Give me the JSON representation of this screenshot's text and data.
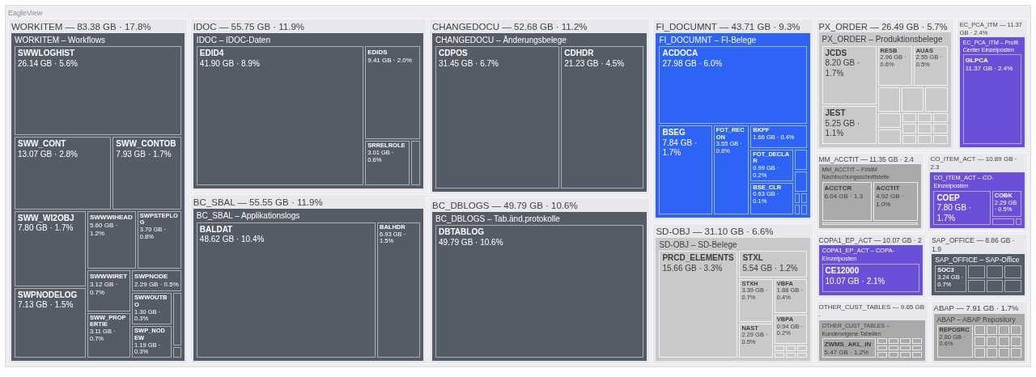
{
  "app_title": "EagleView",
  "categories": [
    {
      "header": "WORKITEM — 83.38 GB · 17.8%",
      "title": "WORKITEM – Workflows",
      "color": "#565c67",
      "tables": [
        {
          "name": "SWWLOGHIST",
          "size": "26.14 GB · 5.6%"
        },
        {
          "name": "SWW_CONT",
          "size": "13.07 GB · 2.8%"
        },
        {
          "name": "SWW_CONTOB",
          "size": "7.93 GB · 1.7%"
        },
        {
          "name": "SWW_WI2OBJ",
          "size": "7.80 GB · 1.7%"
        },
        {
          "name": "SWPNODELOG",
          "size": "7.13 GB · 1.5%"
        },
        {
          "name": "SWWWIHEAD",
          "size": "5.60 GB · 1.2%"
        },
        {
          "name": "SWPSTEPLOG",
          "size": "3.70 GB · 0.8%"
        },
        {
          "name": "SWWWIRET",
          "size": "3.12 GB · 0.7%"
        },
        {
          "name": "SWPNODE",
          "size": "2.29 GB · 0.5%"
        },
        {
          "name": "SWW_PROPERTIE",
          "size": "3.11 GB · 0.7%"
        },
        {
          "name": "SWWOUTBO",
          "size": "1.30 GB · 0.3%"
        },
        {
          "name": "SWP_NODEW",
          "size": "1.19 GB · 0.3%"
        }
      ]
    },
    {
      "header": "IDOC — 55.75 GB · 11.9%",
      "title": "IDOC – IDOC-Daten",
      "color": "#565c67",
      "tables": [
        {
          "name": "EDID4",
          "size": "41.90 GB · 8.9%"
        },
        {
          "name": "EDIDS",
          "size": "9.41 GB · 2.0%"
        },
        {
          "name": "SRRELROLE",
          "size": "3.01 GB · 0.6%"
        }
      ]
    },
    {
      "header": "BC_SBAL — 55.55 GB · 11.9%",
      "title": "BC_SBAL – Applikationslogs",
      "color": "#565c67",
      "tables": [
        {
          "name": "BALDAT",
          "size": "48.62 GB · 10.4%"
        },
        {
          "name": "BALHDR",
          "size": "6.93 GB · 1.5%"
        }
      ]
    },
    {
      "header": "CHANGEDOCU — 52.68 GB · 11.2%",
      "title": "CHANGEDOCU – Änderungsbelege",
      "color": "#565c67",
      "tables": [
        {
          "name": "CDPOS",
          "size": "31.45 GB · 6.7%"
        },
        {
          "name": "CDHDR",
          "size": "21.23 GB · 4.5%"
        }
      ]
    },
    {
      "header": "BC_DBLOGS — 49.79 GB · 10.6%",
      "title": "BC_DBLOGS – Tab.änd.protokolle",
      "color": "#565c67",
      "tables": [
        {
          "name": "DBTABLOG",
          "size": "49.79 GB · 10.6%"
        }
      ]
    },
    {
      "header": "FI_DOCUMNT — 43.71 GB · 9.3%",
      "title": "FI_DOCUMNT – FI-Belege",
      "color": "#2d64f6",
      "tables": [
        {
          "name": "ACDOCA",
          "size": "27.98 GB · 6.0%"
        },
        {
          "name": "BSEG",
          "size": "7.84 GB · 1.7%"
        },
        {
          "name": "FOT_RECON",
          "size": "3.55 GB · 0.8%"
        },
        {
          "name": "BKPF",
          "size": "1.66 GB · 0.4%"
        },
        {
          "name": "FOT_DECLAR",
          "size": "0.99 GB · 0.2%"
        },
        {
          "name": "BSE_CLR",
          "size": "0.63 GB · 0.1%"
        }
      ]
    },
    {
      "header": "SD-OBJ — 31.10 GB · 6.6%",
      "title": "SD-OBJ – SD-Belege",
      "color": "#c9c9c9",
      "tables": [
        {
          "name": "PRCD_ELEMENTS",
          "size": "15.66 GB · 3.3%"
        },
        {
          "name": "STXL",
          "size": "5.54 GB · 1.2%"
        },
        {
          "name": "STXH",
          "size": "3.39 GB · 0.7%"
        },
        {
          "name": "VBFA",
          "size": "1.88 GB · 0.4%"
        },
        {
          "name": "VBPA",
          "size": "0.94 GB · 0.2%"
        },
        {
          "name": "NAST",
          "size": "2.29 GB · 0.5%"
        }
      ]
    },
    {
      "header": "PX_ORDER — 26.49 GB · 5.7%",
      "title": "PX_ORDER – Produktionsbelege",
      "color": "#c9c9c9",
      "tables": [
        {
          "name": "JCDS",
          "size": "8.20 GB · 1.7%"
        },
        {
          "name": "JEST",
          "size": "5.25 GB · 1.1%"
        },
        {
          "name": "RESB",
          "size": "2.96 GB · 0.6%"
        },
        {
          "name": "AUAS",
          "size": "2.55 GB · 0.5%"
        }
      ]
    },
    {
      "header": "EC_PCA_ITM — 11.37 GB · 2.4%",
      "title": "EC_PCA_ITM – Profit Center Einzelposten",
      "color": "#6b4fd8",
      "tables": [
        {
          "name": "GLPCA",
          "size": "11.37 GB · 2.4%"
        }
      ]
    },
    {
      "header": "MM_ACCTIT — 11.35 GB · 2.4",
      "title": "MM_ACCTIT – FI/MM Nachbuchungsschnittstelle",
      "color": "#a9a9a9",
      "tables": [
        {
          "name": "ACCTCR",
          "size": "6.04 GB · 1.3"
        },
        {
          "name": "ACCTIT",
          "size": "4.92 GB · 1.0%"
        }
      ]
    },
    {
      "header": "CO_ITEM_ACT — 10.89 GB · 2.3",
      "title": "CO_ITEM_ACT – CO-Einzelposten",
      "color": "#6b4fd8",
      "tables": [
        {
          "name": "COEP",
          "size": "7.80 GB · 1.7%"
        },
        {
          "name": "COBK",
          "size": "2.29 GB · 0.5%"
        }
      ]
    },
    {
      "header": "COPA1_EP_ACT — 10.07 GB · 2",
      "title": "COPA1_EP_ACT – COPA-Einzelposten",
      "color": "#6b4fd8",
      "tables": [
        {
          "name": "CE12000",
          "size": "10.07 GB · 2.1%"
        }
      ]
    },
    {
      "header": "SAP_OFFICE — 8.86 GB · 1.9",
      "title": "SAP_OFFICE – SAP-Office",
      "color": "#565c67",
      "tables": [
        {
          "name": "SOC3",
          "size": "3.24 GB · 0.7%"
        }
      ]
    },
    {
      "header": "OTHER_CUST_TABLES — 9.65 GB ·",
      "title": "OTHER_CUST_TABLES – Kundeneigene Tabellen",
      "color": "#a9a9a9",
      "tables": [
        {
          "name": "ZWMS_AKL_IN",
          "size": "5.47 GB · 1.2%"
        }
      ]
    },
    {
      "header": "ABAP — 7.91 GB · 1.7%",
      "title": "ABAP – ABAP Repository",
      "color": "#a9a9a9",
      "tables": [
        {
          "name": "REPOSRC",
          "size": "2.80 GB · 0.6%"
        }
      ]
    }
  ]
}
